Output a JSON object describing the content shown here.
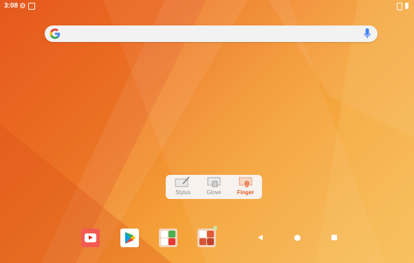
{
  "status_bar": {
    "time": "3:08",
    "icons": [
      "gear-icon",
      "screenshot-icon",
      "sim-icon",
      "battery-icon"
    ]
  },
  "search": {
    "placeholder": "",
    "icons": [
      "google-g-icon",
      "mic-icon"
    ]
  },
  "touch_modes": {
    "items": [
      {
        "label": "Stylus",
        "icon": "stylus-icon",
        "active": false
      },
      {
        "label": "Glove",
        "icon": "glove-icon",
        "active": false
      },
      {
        "label": "Finger",
        "icon": "finger-icon",
        "active": true
      }
    ],
    "accent_color": "#e35a1f"
  },
  "dock": {
    "apps": [
      "youtube-icon",
      "play-store-icon",
      "google-folder-icon",
      "apps-folder-icon"
    ]
  },
  "nav_bar": {
    "buttons": [
      "back-icon",
      "home-icon",
      "recents-icon"
    ]
  },
  "colors": {
    "wallpaper_start": "#e8571f",
    "wallpaper_end": "#f8bf5a"
  }
}
